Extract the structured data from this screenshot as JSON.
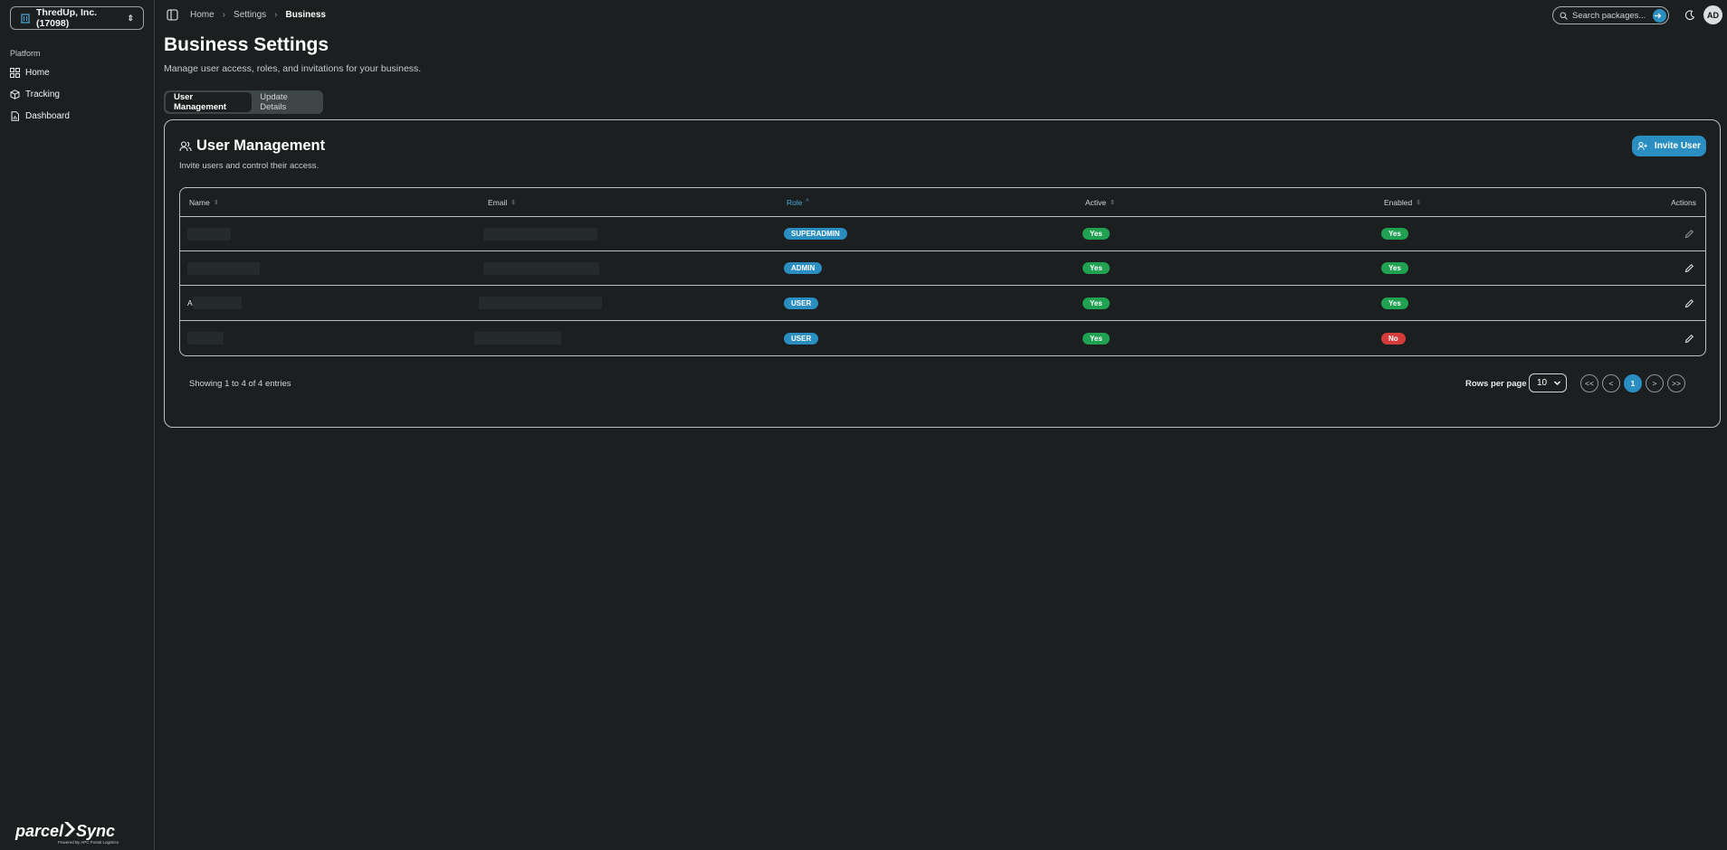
{
  "sidebar": {
    "org_selector": {
      "label": "ThredUp, Inc. (17098)",
      "icon": "building-icon"
    },
    "group_label": "Platform",
    "items": [
      {
        "label": "Home",
        "icon": "grid-icon"
      },
      {
        "label": "Tracking",
        "icon": "package-icon"
      },
      {
        "label": "Dashboard",
        "icon": "file-chart-icon"
      }
    ],
    "logo_text": "parcelSync",
    "logo_tagline": "Powered By APC Postal Logistics"
  },
  "topbar": {
    "breadcrumb": [
      "Home",
      "Settings",
      "Business"
    ],
    "search_placeholder": "Search packages...",
    "avatar_initials": "AD"
  },
  "page": {
    "title": "Business Settings",
    "subtitle": "Manage user access, roles, and invitations for your business.",
    "tabs": [
      "User Management",
      "Update Details"
    ],
    "active_tab": "User Management"
  },
  "card": {
    "title": "User Management",
    "description": "Invite users and control their access.",
    "invite_label": "Invite User"
  },
  "table": {
    "columns": [
      "Name",
      "Email",
      "Role",
      "Active",
      "Enabled",
      "Actions"
    ],
    "sorted_column": "Role",
    "rows": [
      {
        "role": "SUPERADMIN",
        "active": "Yes",
        "enabled": "Yes"
      },
      {
        "role": "ADMIN",
        "active": "Yes",
        "enabled": "Yes"
      },
      {
        "name_prefix": "A",
        "role": "USER",
        "active": "Yes",
        "enabled": "Yes"
      },
      {
        "role": "USER",
        "active": "Yes",
        "enabled": "No"
      }
    ]
  },
  "pagination": {
    "showing": "Showing 1 to 4 of 4 entries",
    "rows_per_page_label": "Rows per page",
    "rows_per_page": "10",
    "buttons": [
      "<<",
      "<",
      "1",
      ">",
      ">>"
    ],
    "current_page": "1"
  },
  "colors": {
    "background": "#1b1f1f",
    "accent": "#2a8ec0",
    "success": "#21a152",
    "danger": "#d43b3b"
  }
}
